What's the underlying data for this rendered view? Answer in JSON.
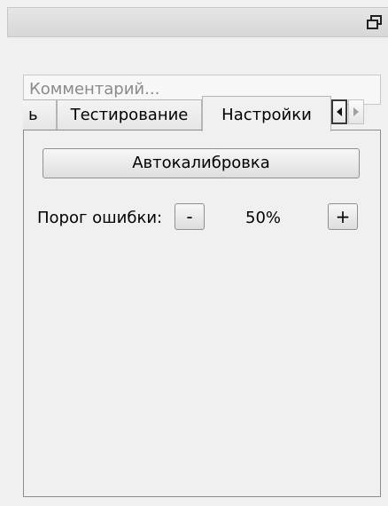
{
  "window": {
    "float_icon": "float-restore-icon"
  },
  "comment": {
    "placeholder": "Комментарий..."
  },
  "tabs": [
    {
      "label": "ь",
      "active": false
    },
    {
      "label": "Тестирование",
      "active": false
    },
    {
      "label": "Настройки",
      "active": true
    }
  ],
  "tab_scroll": {
    "left_icon": "triangle-left-icon",
    "right_icon": "triangle-right-icon"
  },
  "settings": {
    "autocalibration_label": "Автокалибровка",
    "threshold_label": "Порог ошибки:",
    "decrement_label": "-",
    "increment_label": "+",
    "threshold_value": "50%"
  },
  "colors": {
    "background": "#f0f0f0",
    "panel_border": "#8c8c8c",
    "placeholder_text": "#8a8a8a"
  }
}
